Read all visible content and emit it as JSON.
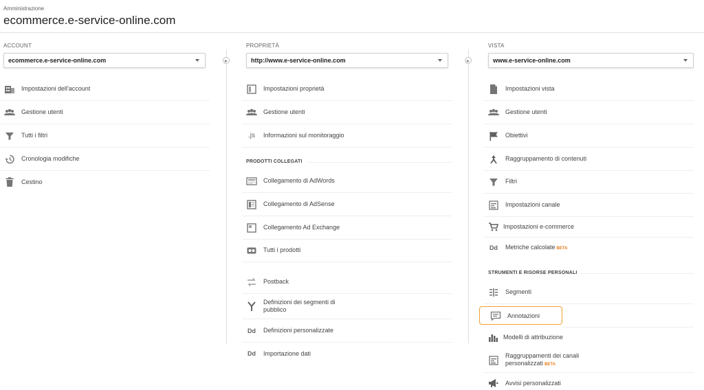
{
  "header": {
    "breadcrumb": "Amministrazione",
    "title": "ecommerce.e-service-online.com"
  },
  "account": {
    "label": "ACCOUNT",
    "selected": "ecommerce.e-service-online.com",
    "items": [
      {
        "label": "Impostazioni dell'account",
        "icon": "building-icon"
      },
      {
        "label": "Gestione utenti",
        "icon": "users-icon"
      },
      {
        "label": "Tutti i filtri",
        "icon": "filter-icon"
      },
      {
        "label": "Cronologia modifiche",
        "icon": "history-icon"
      },
      {
        "label": "Cestino",
        "icon": "trash-icon"
      }
    ]
  },
  "property": {
    "label": "PROPRIETÀ",
    "selected": "http://www.e-service-online.com",
    "items": [
      {
        "label": "Impostazioni proprietà",
        "icon": "property-settings-icon"
      },
      {
        "label": "Gestione utenti",
        "icon": "users-icon"
      },
      {
        "label": "Informazioni sul monitoraggio",
        "icon": "js-icon",
        "icon_text": ".js"
      }
    ],
    "linked_section": "PRODOTTI COLLEGATI",
    "linked_items": [
      {
        "label": "Collegamento di AdWords",
        "icon": "adwords-icon"
      },
      {
        "label": "Collegamento di AdSense",
        "icon": "adsense-icon"
      },
      {
        "label": "Collegamento Ad Exchange",
        "icon": "ad-exchange-icon"
      },
      {
        "label": "Tutti i prodotti",
        "icon": "all-products-icon"
      }
    ],
    "other_items": [
      {
        "label": "Postback",
        "icon": "postback-icon"
      },
      {
        "label": "Definizioni dei segmenti di pubblico",
        "icon": "audience-icon"
      },
      {
        "label": "Definizioni personalizzate",
        "icon": "dd-icon",
        "icon_text": "Dd"
      },
      {
        "label": "Importazione dati",
        "icon": "dd-icon",
        "icon_text": "Dd"
      }
    ]
  },
  "view": {
    "label": "VISTA",
    "selected": "www.e-service-online.com",
    "items": [
      {
        "label": "Impostazioni vista",
        "icon": "document-icon"
      },
      {
        "label": "Gestione utenti",
        "icon": "users-icon"
      },
      {
        "label": "Obiettivi",
        "icon": "flag-icon"
      },
      {
        "label": "Raggruppamento di contenuti",
        "icon": "grouping-icon"
      },
      {
        "label": "Filtri",
        "icon": "filter-icon"
      },
      {
        "label": "Impostazioni canale",
        "icon": "channel-icon"
      },
      {
        "label": "Impostazioni e-commerce",
        "icon": "cart-icon"
      },
      {
        "label": "Metriche calcolate",
        "icon": "dd-icon",
        "icon_text": "Dd",
        "badge": "BETA"
      }
    ],
    "tools_section": "STRUMENTI E RISORSE PERSONALI",
    "tools_items": [
      {
        "label": "Segmenti",
        "icon": "segments-icon"
      },
      {
        "label": "Annotazioni",
        "icon": "annotation-icon",
        "highlighted": true
      },
      {
        "label": "Modelli di attribuzione",
        "icon": "bar-chart-icon"
      },
      {
        "label": "Raggruppamenti dei canali personalizzati",
        "icon": "channel-icon",
        "badge": "BETA"
      },
      {
        "label": "Avvisi personalizzati",
        "icon": "megaphone-icon"
      }
    ]
  },
  "colors": {
    "icon": "#616161",
    "highlight_border": "#f2a02d",
    "beta": "#e67c1a"
  }
}
